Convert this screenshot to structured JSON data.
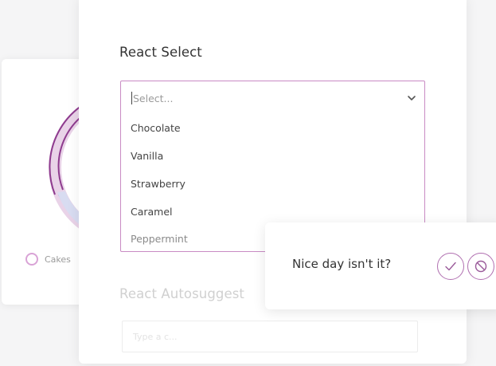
{
  "chart_legend": {
    "items": [
      {
        "label": "Cakes",
        "color": "#d9a3d6"
      }
    ]
  },
  "colors": {
    "accent": "#c98bc4",
    "donut_primary": "#8e3b8e",
    "donut_secondary": "#7a86c8",
    "donut_fill": "#e9d3e8"
  },
  "react_select": {
    "title": "React Select",
    "placeholder": "Select...",
    "options": [
      {
        "label": "Chocolate"
      },
      {
        "label": "Vanilla"
      },
      {
        "label": "Strawberry"
      },
      {
        "label": "Caramel"
      },
      {
        "label": "Peppermint"
      }
    ],
    "chevron_icon": "chevron-down-icon"
  },
  "react_autosuggest": {
    "title": "React Autosuggest",
    "placeholder": "Type a c..."
  },
  "toast": {
    "message": "Nice day isn't it?",
    "confirm_icon": "check-icon",
    "cancel_icon": "ban-icon"
  }
}
